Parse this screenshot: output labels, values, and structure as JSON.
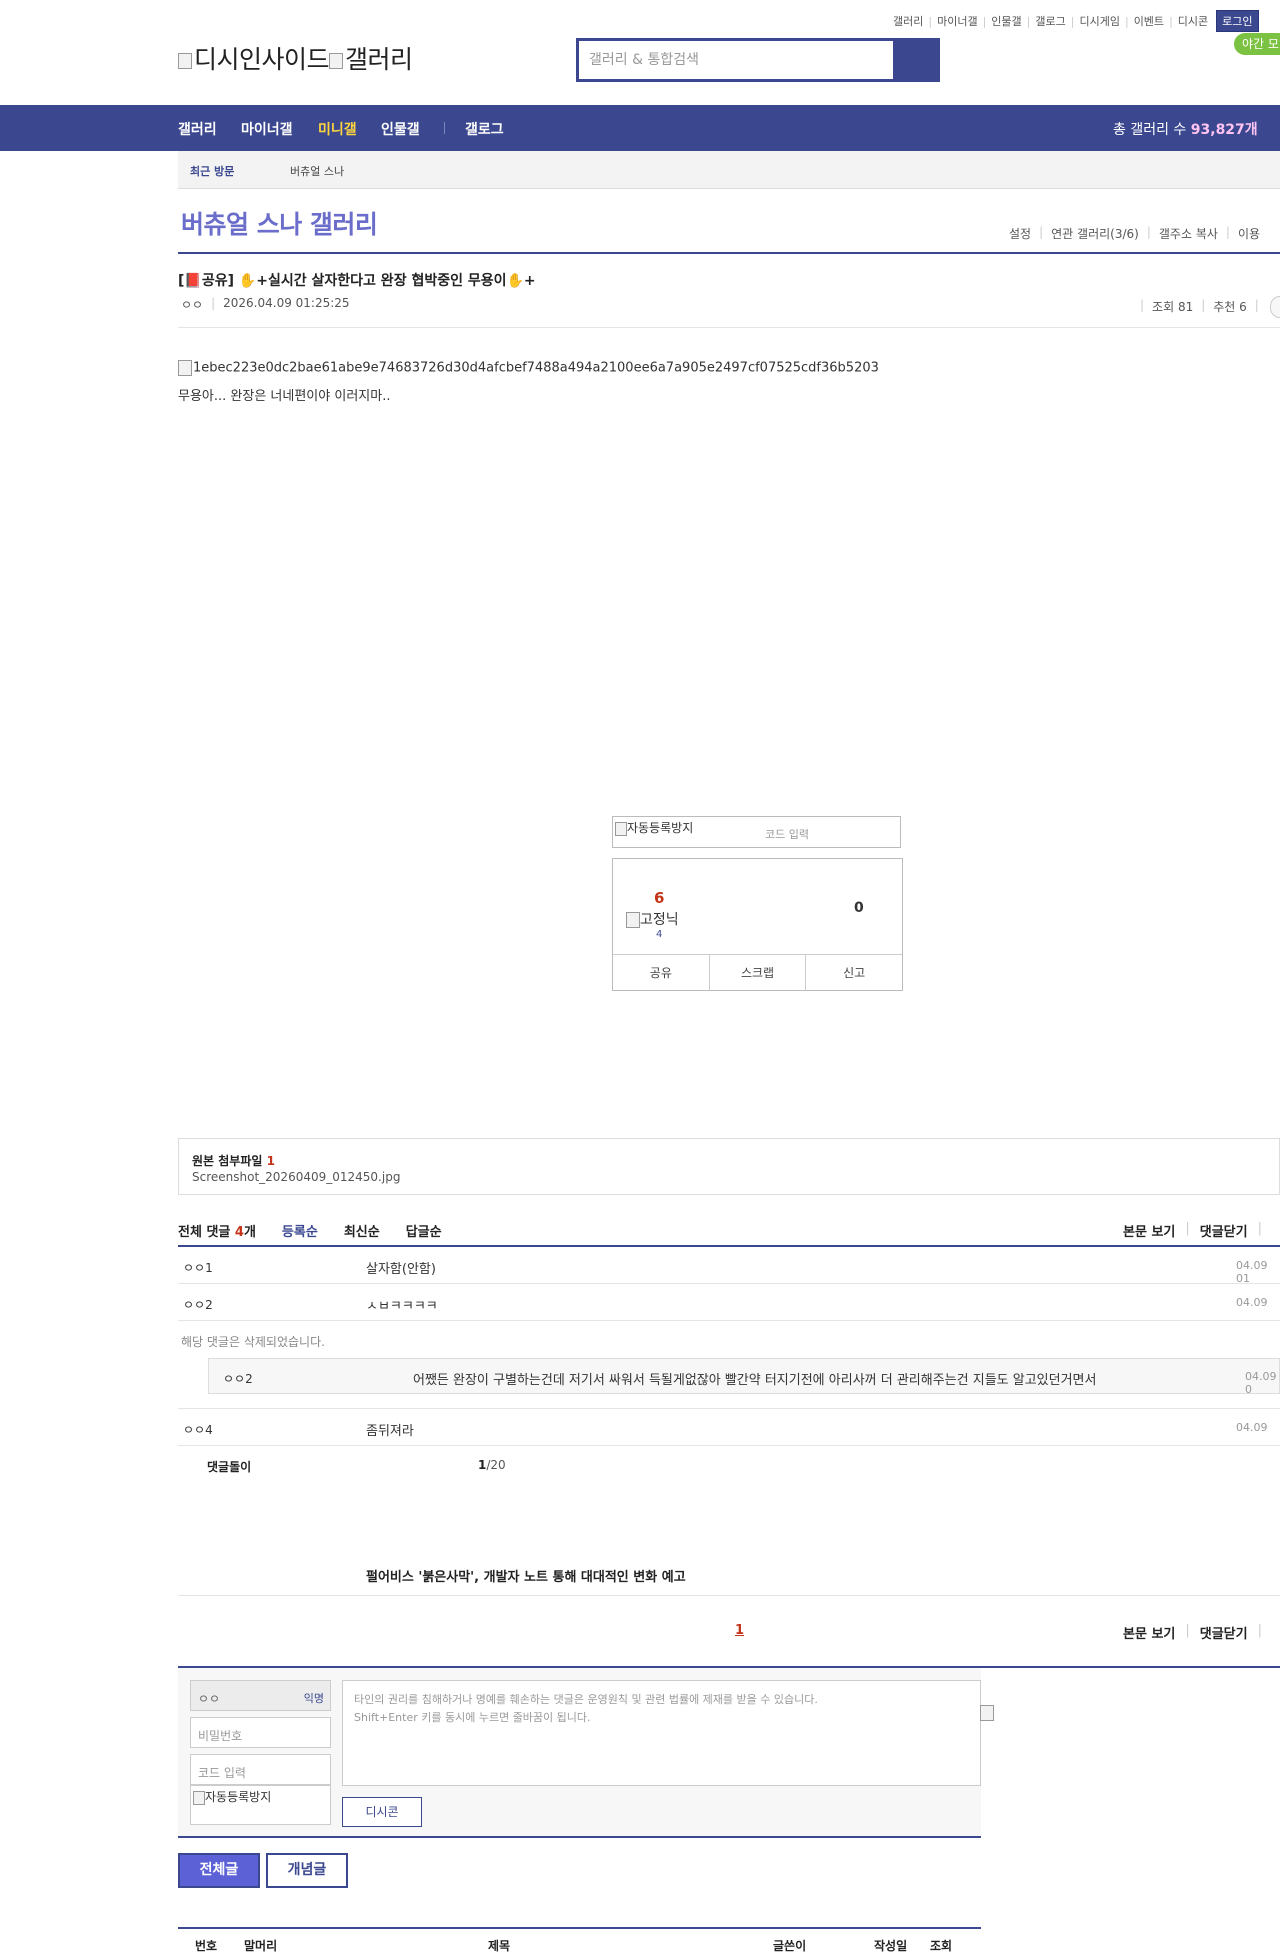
{
  "util": {
    "links": [
      "갤러리",
      "마이너갤",
      "인물갤",
      "갤로그",
      "디시게임",
      "이벤트",
      "디시콘"
    ],
    "login": "로그인",
    "night": "야간 모"
  },
  "logo": {
    "dc": "디시인사이드",
    "gallery": "갤러리"
  },
  "search": {
    "placeholder": "갤러리 & 통합검색"
  },
  "gnb": {
    "items": [
      "갤러리",
      "마이너갤",
      "미니갤",
      "인물갤",
      "갤로그"
    ],
    "total_label": "총 갤러리 수",
    "total_value": "93,827개"
  },
  "visit": {
    "label": "최근 방문",
    "gallery": "버츄얼 스나"
  },
  "gallery": {
    "title": "버츄얼 스나 갤러리",
    "menu": [
      "설정",
      "연관 갤러리(3/6)",
      "갤주소 복사",
      "이용"
    ]
  },
  "post": {
    "title": "[📕공유] ✋+실시간 살자한다고 완장 협박중인 무용이✋+",
    "author": "ㅇㅇ",
    "datetime": "2026.04.09 01:25:25",
    "views": "조회 81",
    "recommend": "추천 6",
    "image_alt": "1ebec223e0dc2bae61abe9e74683726d30d4afcbef7488a494a2100ee6a7a905e2497cf07525cdf36b5203",
    "body": "무용아... 완장은 너네편이야 이러지마.."
  },
  "captcha": {
    "img_alt": "자동등록방지",
    "placeholder": "코드 입력"
  },
  "recommend_box": {
    "up": "6",
    "fixed_alt": "고정닉",
    "fixed_count": "4",
    "down": "0",
    "share": "공유",
    "scrap": "스크랩",
    "report": "신고"
  },
  "attach": {
    "title": "원본 첨부파일",
    "count": "1",
    "file": "Screenshot_20260409_012450.jpg"
  },
  "comments": {
    "total_label": "전체 댓글",
    "total_count": "4",
    "total_unit": "개",
    "sort": [
      "등록순",
      "최신순",
      "답글순"
    ],
    "view_body": "본문 보기",
    "close": "댓글닫기",
    "rows": [
      {
        "nick": "ㅇㅇ1",
        "text": "살자함(안함)",
        "date": "04.09 01"
      },
      {
        "nick": "ㅇㅇ2",
        "text": "ㅅㅂㅋㅋㅋㅋ",
        "date": "04.09"
      }
    ],
    "deleted": "해당 댓글은 삭제되었습니다.",
    "reply": {
      "nick": "ㅇㅇ2",
      "text": "어쨌든 완장이 구별하는건데 저기서 싸워서 득될게없잖아 빨간약 터지기전에 아리사꺼 더 관리해주는건 지들도 알고있던거면서",
      "date": "04.09 0"
    },
    "row4": {
      "nick": "ㅇㅇ4",
      "text": "좀뒤져라",
      "date": "04.09"
    },
    "dolgi": "댓글돌이",
    "dolgi_cur": "1",
    "dolgi_total": "/20"
  },
  "news": {
    "text": "펄어비스 '붉은사막', 개발자 노트 통해 대대적인 변화 예고"
  },
  "pagination": {
    "current": "1"
  },
  "write": {
    "nick": "ㅇㅇ",
    "anon": "익명",
    "password": "비밀번호",
    "code": "코드 입력",
    "captcha_alt": "자동등록방지",
    "notice1": "타인의 권리를 침해하거나 명예를 훼손하는 댓글은 운영원칙 및 관련 법률에 제재를 받을 수 있습니다.",
    "notice2": "Shift+Enter 키를 동시에 누르면 줄바꿈이 됩니다.",
    "dccon": "디시콘"
  },
  "tabs": {
    "all": "전체글",
    "best": "개념글"
  },
  "list_header": [
    "번호",
    "말머리",
    "제목",
    "글쓴이",
    "작성일",
    "조회"
  ]
}
